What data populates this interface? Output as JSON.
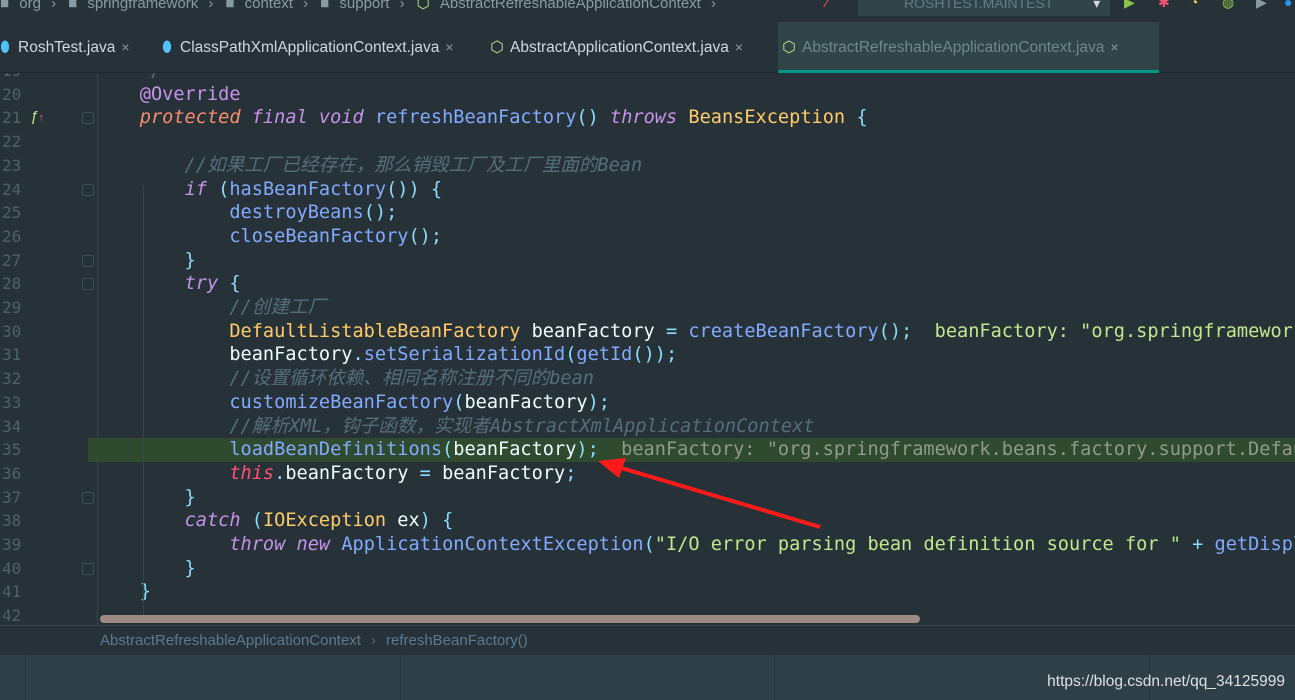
{
  "nav_breadcrumb": [
    "org",
    "springframework",
    "context",
    "support",
    "AbstractRefreshableApplicationContext"
  ],
  "run_config": "ROSHTEST.MAINTEST",
  "tabs": [
    {
      "label": "RoshTest.java",
      "icon": "class-icon",
      "active": false
    },
    {
      "label": "ClassPathXmlApplicationContext.java",
      "icon": "class-icon",
      "active": false
    },
    {
      "label": "AbstractApplicationContext.java",
      "icon": "abstract-class-icon",
      "active": false
    },
    {
      "label": "AbstractRefreshableApplicationContext.java",
      "icon": "abstract-class-icon",
      "active": true
    }
  ],
  "close_glyph": "×",
  "current_line": 35,
  "colors": {
    "background": "#263238",
    "active_tab_underline": "#009688",
    "execution_line": "#2f4a2f",
    "arrow": "#ff1a1a"
  },
  "lines": [
    {
      "n": "19",
      "t": [
        [
          "cm",
          "    */"
        ]
      ]
    },
    {
      "n": "20",
      "t": [
        [
          "ann",
          "    @Override"
        ]
      ]
    },
    {
      "n": "21",
      "t": [
        [
          "id",
          "    "
        ],
        [
          "kwo",
          "protected"
        ],
        [
          "id",
          " "
        ],
        [
          "kw",
          "final"
        ],
        [
          "id",
          " "
        ],
        [
          "kw",
          "void"
        ],
        [
          "id",
          " "
        ],
        [
          "fn",
          "refreshBeanFactory"
        ],
        [
          "pu",
          "()"
        ],
        [
          "id",
          " "
        ],
        [
          "kw",
          "throws"
        ],
        [
          "id",
          " "
        ],
        [
          "ty",
          "BeansException"
        ],
        [
          "id",
          " "
        ],
        [
          "pu",
          "{"
        ]
      ]
    },
    {
      "n": "22",
      "t": []
    },
    {
      "n": "23",
      "t": [
        [
          "cm",
          "        //如果工厂已经存在，那么销毁工厂及工厂里面的Bean"
        ]
      ]
    },
    {
      "n": "24",
      "t": [
        [
          "id",
          "        "
        ],
        [
          "kw",
          "if"
        ],
        [
          "id",
          " "
        ],
        [
          "pu",
          "("
        ],
        [
          "fn",
          "hasBeanFactory"
        ],
        [
          "pu",
          "()) {"
        ]
      ]
    },
    {
      "n": "25",
      "t": [
        [
          "id",
          "            "
        ],
        [
          "fn",
          "destroyBeans"
        ],
        [
          "pu",
          "();"
        ]
      ]
    },
    {
      "n": "26",
      "t": [
        [
          "id",
          "            "
        ],
        [
          "fn",
          "closeBeanFactory"
        ],
        [
          "pu",
          "();"
        ]
      ]
    },
    {
      "n": "27",
      "t": [
        [
          "pu",
          "        }"
        ]
      ]
    },
    {
      "n": "28",
      "t": [
        [
          "id",
          "        "
        ],
        [
          "kw",
          "try"
        ],
        [
          "id",
          " "
        ],
        [
          "pu",
          "{"
        ]
      ]
    },
    {
      "n": "29",
      "t": [
        [
          "cm",
          "            //创建工厂"
        ]
      ]
    },
    {
      "n": "30",
      "t": [
        [
          "id",
          "            "
        ],
        [
          "ty",
          "DefaultListableBeanFactory"
        ],
        [
          "id",
          " beanFactory "
        ],
        [
          "pu",
          "="
        ],
        [
          "id",
          " "
        ],
        [
          "fn",
          "createBeanFactory"
        ],
        [
          "pu",
          "();"
        ],
        [
          "hint",
          "  beanFactory: \"org.springframework."
        ]
      ]
    },
    {
      "n": "31",
      "t": [
        [
          "id",
          "            beanFactory"
        ],
        [
          "pu",
          "."
        ],
        [
          "fn",
          "setSerializationId"
        ],
        [
          "pu",
          "("
        ],
        [
          "fn",
          "getId"
        ],
        [
          "pu",
          "());"
        ]
      ]
    },
    {
      "n": "32",
      "t": [
        [
          "cm",
          "            //设置循环依赖、相同名称注册不同的bean"
        ]
      ]
    },
    {
      "n": "33",
      "t": [
        [
          "id",
          "            "
        ],
        [
          "fn",
          "customizeBeanFactory"
        ],
        [
          "pu",
          "("
        ],
        [
          "id",
          "beanFactory"
        ],
        [
          "pu",
          ");"
        ]
      ]
    },
    {
      "n": "34",
      "t": [
        [
          "cm",
          "            //解析XML，钩子函数，实现者AbstractXmlApplicationContext"
        ]
      ]
    },
    {
      "n": "35",
      "t": [
        [
          "id",
          "            "
        ],
        [
          "fn",
          "loadBeanDefinitions"
        ],
        [
          "pu",
          "("
        ],
        [
          "id",
          "beanFactory"
        ],
        [
          "pu",
          ");"
        ],
        [
          "hint2",
          "  beanFactory: \"org.springframework.beans.factory.support.Defaul"
        ]
      ]
    },
    {
      "n": "36",
      "t": [
        [
          "id",
          "            "
        ],
        [
          "th",
          "this"
        ],
        [
          "pu",
          "."
        ],
        [
          "id",
          "beanFactory "
        ],
        [
          "pu",
          "="
        ],
        [
          "id",
          " beanFactory"
        ],
        [
          "pu",
          ";"
        ]
      ]
    },
    {
      "n": "37",
      "t": [
        [
          "pu",
          "        }"
        ]
      ]
    },
    {
      "n": "38",
      "t": [
        [
          "id",
          "        "
        ],
        [
          "kw",
          "catch"
        ],
        [
          "id",
          " "
        ],
        [
          "pu",
          "("
        ],
        [
          "ty",
          "IOException"
        ],
        [
          "id",
          " ex"
        ],
        [
          "pu",
          ") {"
        ]
      ]
    },
    {
      "n": "39",
      "t": [
        [
          "id",
          "            "
        ],
        [
          "kw",
          "throw"
        ],
        [
          "id",
          " "
        ],
        [
          "kw",
          "new"
        ],
        [
          "id",
          " "
        ],
        [
          "fn",
          "ApplicationContextException"
        ],
        [
          "pu",
          "("
        ],
        [
          "st",
          "\"I/O error parsing bean definition source for \""
        ],
        [
          "id",
          " "
        ],
        [
          "pu",
          "+"
        ],
        [
          "id",
          " "
        ],
        [
          "fn",
          "getDispla"
        ]
      ]
    },
    {
      "n": "40",
      "t": [
        [
          "pu",
          "        }"
        ]
      ]
    },
    {
      "n": "41",
      "t": [
        [
          "pu",
          "    }"
        ]
      ]
    },
    {
      "n": "42",
      "t": []
    }
  ],
  "folds": [
    "21",
    "24",
    "27",
    "28",
    "37",
    "40"
  ],
  "bottom_breadcrumb": {
    "class": "AbstractRefreshableApplicationContext",
    "sep": "›",
    "method": "refreshBeanFactory()"
  },
  "watermark": "https://blog.csdn.net/qq_34125999"
}
